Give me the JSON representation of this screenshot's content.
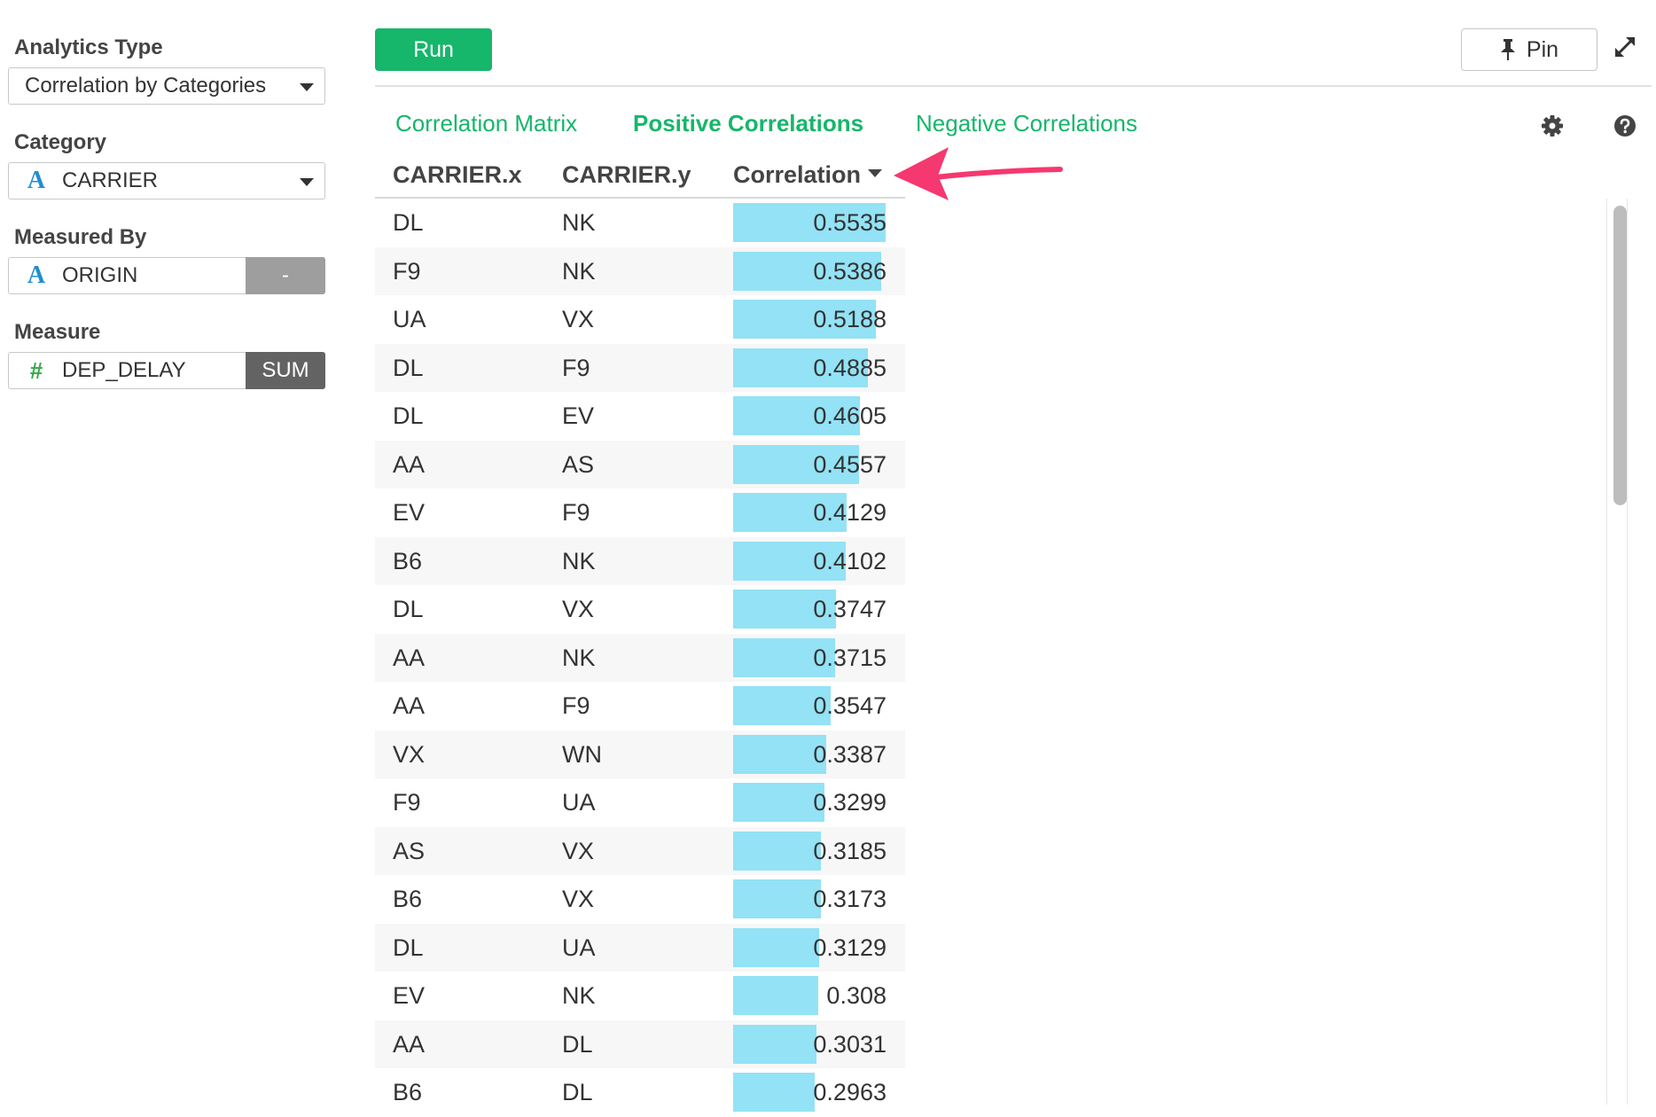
{
  "sidebar": {
    "analytics_type": {
      "label": "Analytics Type",
      "value": "Correlation by Categories"
    },
    "category": {
      "label": "Category",
      "value": "CARRIER",
      "icon": "A"
    },
    "measured_by": {
      "label": "Measured By",
      "value": "ORIGIN",
      "icon": "A",
      "button": "-"
    },
    "measure": {
      "label": "Measure",
      "value": "DEP_DELAY",
      "icon": "#",
      "aggregation": "SUM"
    }
  },
  "toolbar": {
    "run_label": "Run",
    "pin_label": "Pin"
  },
  "tabs": [
    {
      "label": "Correlation Matrix",
      "active": false
    },
    {
      "label": "Positive Correlations",
      "active": true
    },
    {
      "label": "Negative Correlations",
      "active": false
    }
  ],
  "table": {
    "columns": [
      "CARRIER.x",
      "CARRIER.y",
      "Correlation"
    ],
    "rows": [
      {
        "x": "DL",
        "y": "NK",
        "corr": "0.5535"
      },
      {
        "x": "F9",
        "y": "NK",
        "corr": "0.5386"
      },
      {
        "x": "UA",
        "y": "VX",
        "corr": "0.5188"
      },
      {
        "x": "DL",
        "y": "F9",
        "corr": "0.4885"
      },
      {
        "x": "DL",
        "y": "EV",
        "corr": "0.4605"
      },
      {
        "x": "AA",
        "y": "AS",
        "corr": "0.4557"
      },
      {
        "x": "EV",
        "y": "F9",
        "corr": "0.4129"
      },
      {
        "x": "B6",
        "y": "NK",
        "corr": "0.4102"
      },
      {
        "x": "DL",
        "y": "VX",
        "corr": "0.3747"
      },
      {
        "x": "AA",
        "y": "NK",
        "corr": "0.3715"
      },
      {
        "x": "AA",
        "y": "F9",
        "corr": "0.3547"
      },
      {
        "x": "VX",
        "y": "WN",
        "corr": "0.3387"
      },
      {
        "x": "F9",
        "y": "UA",
        "corr": "0.3299"
      },
      {
        "x": "AS",
        "y": "VX",
        "corr": "0.3185"
      },
      {
        "x": "B6",
        "y": "VX",
        "corr": "0.3173"
      },
      {
        "x": "DL",
        "y": "UA",
        "corr": "0.3129"
      },
      {
        "x": "EV",
        "y": "NK",
        "corr": "0.308"
      },
      {
        "x": "AA",
        "y": "DL",
        "corr": "0.3031"
      },
      {
        "x": "B6",
        "y": "DL",
        "corr": "0.2963"
      }
    ]
  },
  "colors": {
    "accent": "#16b66b",
    "bar": "#93e2f5",
    "annotation_arrow": "#f5386f",
    "measured_by_button": "#9e9e9e",
    "aggregation_button": "#636363"
  }
}
